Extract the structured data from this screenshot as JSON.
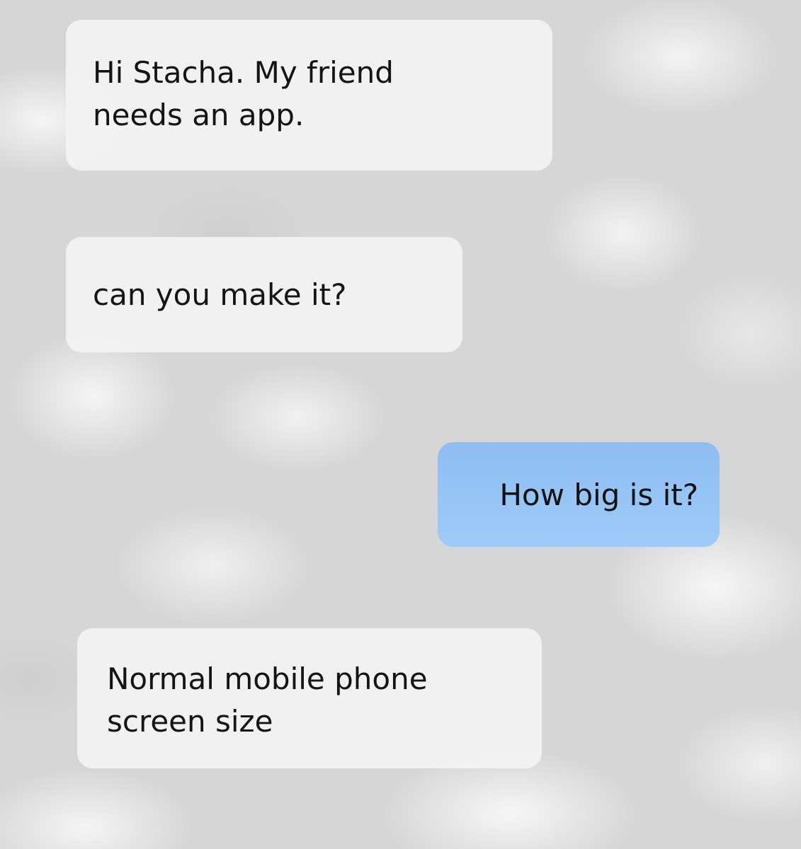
{
  "conversation": {
    "messages": [
      {
        "direction": "incoming",
        "text": "Hi Stacha. My friend\nneeds an app."
      },
      {
        "direction": "incoming",
        "text": "can you make it?"
      },
      {
        "direction": "outgoing",
        "text": "How big is it?"
      },
      {
        "direction": "incoming",
        "text": "Normal mobile phone\nscreen size"
      }
    ]
  },
  "colors": {
    "incoming_bubble": "#f4f4f4",
    "outgoing_bubble": "#96c4f6",
    "background": "#d6d6d6",
    "text": "#141414"
  }
}
